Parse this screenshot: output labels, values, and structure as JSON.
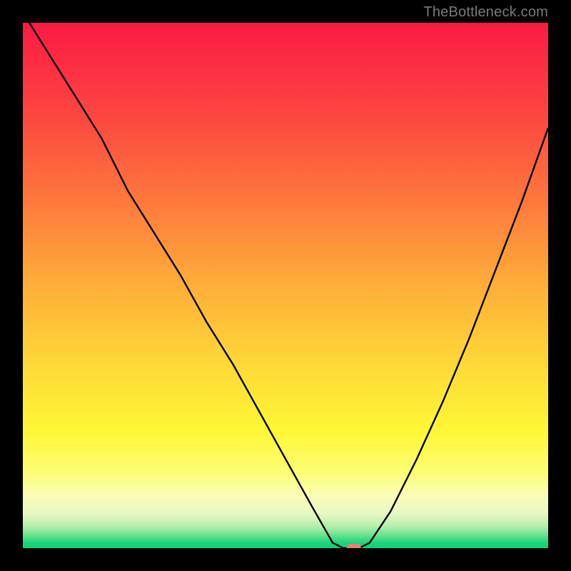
{
  "attribution": "TheBottleneck.com",
  "chart_data": {
    "type": "line",
    "title": "",
    "xlabel": "",
    "ylabel": "",
    "xlim": [
      0,
      100
    ],
    "ylim": [
      0,
      100
    ],
    "grid": false,
    "legend": false,
    "annotations": [],
    "series": [
      {
        "name": "bottleneck-curve",
        "x": [
          0,
          5,
          10,
          15,
          20,
          25,
          30,
          35,
          40,
          45,
          50,
          55,
          59,
          61,
          64,
          66,
          70,
          75,
          80,
          85,
          90,
          95,
          100
        ],
        "values": [
          102,
          94,
          86,
          78,
          68,
          60,
          52,
          43,
          35,
          26,
          17,
          8,
          1,
          0,
          0,
          1,
          7,
          17,
          28,
          40,
          53,
          66,
          80
        ]
      }
    ],
    "marker": {
      "x": 63,
      "y": 0,
      "color": "#ef7b74"
    },
    "background_gradient": {
      "stops": [
        {
          "offset": 0.0,
          "color": "#fb1a45"
        },
        {
          "offset": 0.18,
          "color": "#fd4740"
        },
        {
          "offset": 0.35,
          "color": "#fe7c3c"
        },
        {
          "offset": 0.5,
          "color": "#feae39"
        },
        {
          "offset": 0.65,
          "color": "#fed937"
        },
        {
          "offset": 0.78,
          "color": "#fef836"
        },
        {
          "offset": 0.86,
          "color": "#fdfe79"
        },
        {
          "offset": 0.9,
          "color": "#fbfdb9"
        },
        {
          "offset": 0.935,
          "color": "#e7f8c4"
        },
        {
          "offset": 0.958,
          "color": "#b6efac"
        },
        {
          "offset": 0.975,
          "color": "#6ce18f"
        },
        {
          "offset": 0.99,
          "color": "#1ad47b"
        },
        {
          "offset": 1.0,
          "color": "#0fd277"
        }
      ]
    }
  }
}
